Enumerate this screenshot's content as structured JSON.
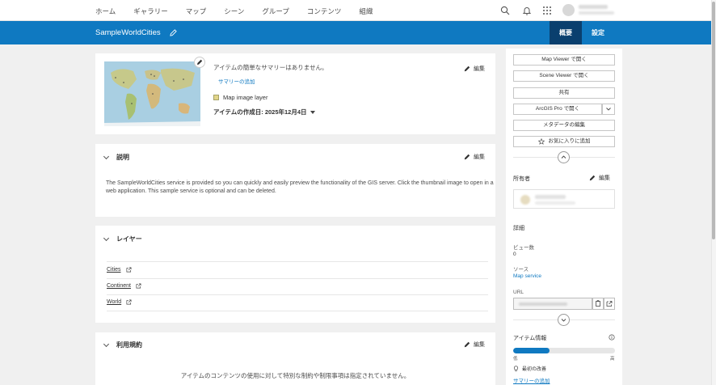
{
  "nav": {
    "items": [
      "ホーム",
      "ギャラリー",
      "マップ",
      "シーン",
      "グループ",
      "コンテンツ",
      "組織"
    ]
  },
  "header": {
    "title": "SampleWorldCities",
    "tabs": {
      "overview": "概要",
      "settings": "設定"
    }
  },
  "summary": {
    "no_summary": "アイテムの簡単なサマリーはありません。",
    "add_summary": "サマリーの追加",
    "type": "Map image layer",
    "created": "アイテムの作成日: 2025年12月4日",
    "edit": "編集"
  },
  "description": {
    "heading": "説明",
    "edit": "編集",
    "text": "The SampleWorldCities service is provided so you can quickly and easily preview the functionality of the GIS server. Click the thumbnail image to open in a web application. This sample service is optional and can be deleted."
  },
  "layers": {
    "heading": "レイヤー",
    "items": [
      "Cities",
      "Continent",
      "World"
    ]
  },
  "terms": {
    "heading": "利用規約",
    "edit": "編集",
    "text": "アイテムのコンテンツの使用に対して特別な制約や制限事項は指定されていません。"
  },
  "sidebar": {
    "buttons": {
      "map_viewer": "Map Viewer で開く",
      "scene_viewer": "Scene Viewer で開く",
      "share": "共有",
      "arcgis_pro": "ArcGIS Pro で開く",
      "metadata": "メタデータの編集",
      "favorite": "お気に入りに追加"
    },
    "owner": {
      "label": "所有者",
      "edit": "編集"
    },
    "details": {
      "heading": "詳細",
      "views_label": "ビュー数",
      "views_value": "0",
      "source_label": "ソース",
      "source_value": "Map service",
      "url_label": "URL"
    },
    "item_info": {
      "heading": "アイテム情報",
      "low": "低",
      "high": "高",
      "progress": 0.36,
      "tip": "最初の改善",
      "tip_link": "サマリーの追加"
    }
  },
  "colors": {
    "brand": "#0f79c1",
    "active_tab": "#0a3f6e"
  }
}
